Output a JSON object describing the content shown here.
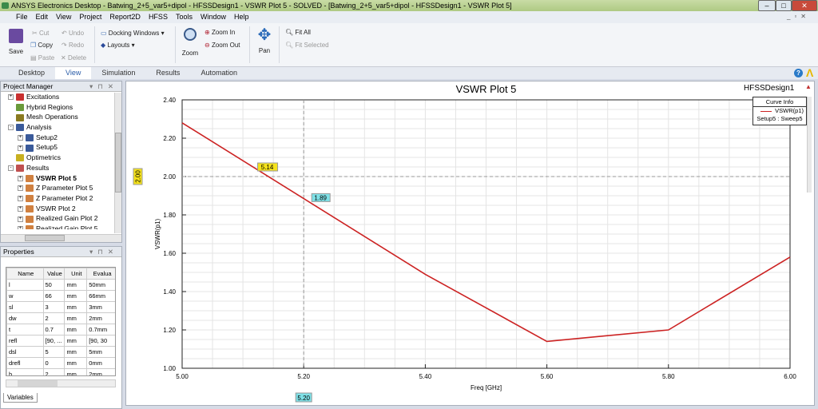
{
  "window": {
    "title": "ANSYS Electronics Desktop - Batwing_2+5_var5+dipol - HFSSDesign1 - VSWR Plot 5 - SOLVED - [Batwing_2+5_var5+dipol - HFSSDesign1 - VSWR Plot 5]"
  },
  "menu": [
    "File",
    "Edit",
    "View",
    "Project",
    "Report2D",
    "HFSS",
    "Tools",
    "Window",
    "Help"
  ],
  "ribbon": {
    "save": "Save",
    "cut": "Cut",
    "copy": "Copy",
    "paste": "Paste",
    "undo": "Undo",
    "redo": "Redo",
    "delete": "Delete",
    "docking": "Docking Windows",
    "layouts": "Layouts",
    "zoom": "Zoom",
    "zoom_in": "Zoom In",
    "zoom_out": "Zoom Out",
    "pan": "Pan",
    "fit_all": "Fit All",
    "fit_selected": "Fit Selected"
  },
  "tabs": [
    {
      "label": "Desktop"
    },
    {
      "label": "View",
      "active": true
    },
    {
      "label": "Simulation"
    },
    {
      "label": "Results"
    },
    {
      "label": "Automation"
    }
  ],
  "project_manager": {
    "title": "Project Manager",
    "items": [
      {
        "label": "Excitations",
        "level": 1,
        "exp": "+",
        "color": "#c83030"
      },
      {
        "label": "Hybrid Regions",
        "level": 1,
        "exp": "",
        "color": "#6a9a3a"
      },
      {
        "label": "Mesh Operations",
        "level": 1,
        "exp": "",
        "color": "#8a7a20"
      },
      {
        "label": "Analysis",
        "level": 1,
        "exp": "-",
        "color": "#3a5a9a"
      },
      {
        "label": "Setup2",
        "level": 2,
        "exp": "+",
        "color": "#3a5a9a"
      },
      {
        "label": "Setup5",
        "level": 2,
        "exp": "+",
        "color": "#3a5a9a"
      },
      {
        "label": "Optimetrics",
        "level": 1,
        "exp": "",
        "color": "#c8b020"
      },
      {
        "label": "Results",
        "level": 1,
        "exp": "-",
        "color": "#c05050"
      },
      {
        "label": "VSWR Plot 5",
        "level": 2,
        "exp": "+",
        "color": "#d08040",
        "bold": true
      },
      {
        "label": "Z Parameter Plot 5",
        "level": 2,
        "exp": "+",
        "color": "#d08040"
      },
      {
        "label": "Z Parameter Plot 2",
        "level": 2,
        "exp": "+",
        "color": "#d08040"
      },
      {
        "label": "VSWR Plot 2",
        "level": 2,
        "exp": "+",
        "color": "#d08040"
      },
      {
        "label": "Realized Gain Plot 2",
        "level": 2,
        "exp": "+",
        "color": "#d08040"
      },
      {
        "label": "Realized Gain Plot 5",
        "level": 2,
        "exp": "+",
        "color": "#d08040"
      }
    ]
  },
  "properties": {
    "title": "Properties",
    "columns": [
      "Name",
      "Value",
      "Unit",
      "Evalua"
    ],
    "rows": [
      [
        "l",
        "50",
        "mm",
        "50mm"
      ],
      [
        "w",
        "66",
        "mm",
        "66mm"
      ],
      [
        "sl",
        "3",
        "mm",
        "3mm"
      ],
      [
        "dw",
        "2",
        "mm",
        "2mm"
      ],
      [
        "t",
        "0.7",
        "mm",
        "0.7mm"
      ],
      [
        "refl",
        "[90, ...",
        "mm",
        "[90, 30"
      ],
      [
        "dsl",
        "5",
        "mm",
        "5mm"
      ],
      [
        "drefl",
        "0",
        "mm",
        "0mm"
      ],
      [
        "h",
        "2",
        "mm",
        "2mm"
      ]
    ],
    "tab": "Variables"
  },
  "plot": {
    "design": "HFSSDesign1",
    "curve_info_title": "Curve Info",
    "curve_name": "VSWR(p1)",
    "curve_source": "Setup5 : Sweep5"
  },
  "chart_data": {
    "type": "line",
    "title": "VSWR Plot 5",
    "xlabel": "Freq [GHz]",
    "ylabel": "VSWR(p1)",
    "xlim": [
      5.0,
      6.0
    ],
    "ylim": [
      1.0,
      2.4
    ],
    "grid": true,
    "legend": "top-right",
    "xticks": [
      "5.00",
      "5.20",
      "5.40",
      "5.60",
      "5.80",
      "6.00"
    ],
    "yticks": [
      "1.00",
      "1.20",
      "1.40",
      "1.60",
      "1.80",
      "2.00",
      "2.20",
      "2.40"
    ],
    "series": [
      {
        "name": "VSWR(p1)",
        "color": "#cc2222",
        "x": [
          5.0,
          5.4,
          5.6,
          5.8,
          6.0
        ],
        "y": [
          2.28,
          1.49,
          1.14,
          1.2,
          1.58
        ]
      }
    ],
    "markers": {
      "y_line": "2.00",
      "y_line_value": 2.0,
      "x_line": "5.20",
      "x_line_value": 5.2,
      "intersect_x": "5.14",
      "intersect_x_value": 5.14,
      "intersect_y": "1.89",
      "intersect_y_value": 1.89
    }
  }
}
